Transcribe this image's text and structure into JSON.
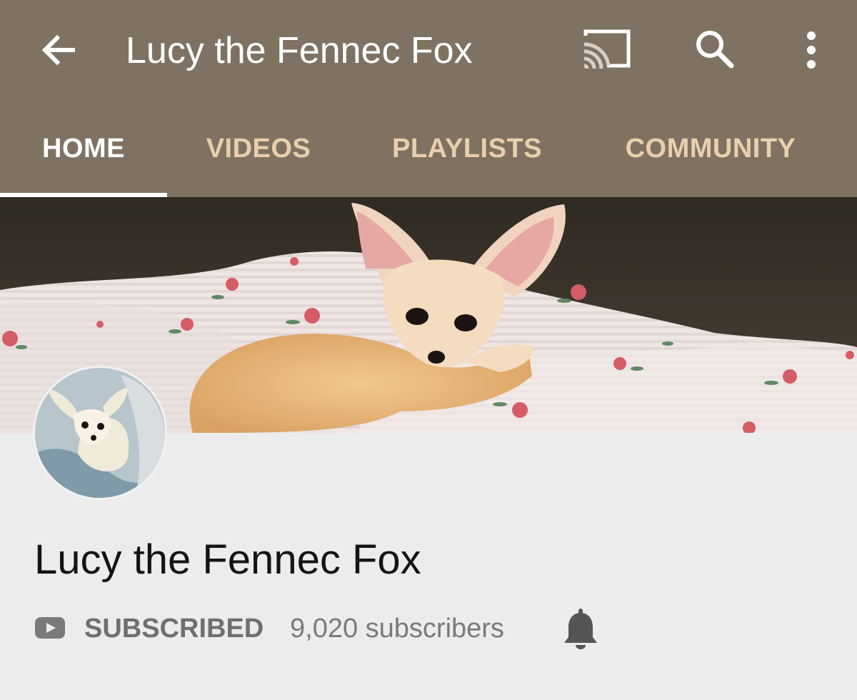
{
  "header": {
    "title": "Lucy the Fennec Fox",
    "back_icon": "arrow-back-icon",
    "cast_icon": "cast-icon",
    "search_icon": "search-icon",
    "more_icon": "more-vert-icon",
    "background_color": "#7f7262"
  },
  "tabs": [
    {
      "label": "HOME",
      "active": true
    },
    {
      "label": "VIDEOS",
      "active": false
    },
    {
      "label": "PLAYLISTS",
      "active": false
    },
    {
      "label": "COMMUNITY",
      "active": false
    }
  ],
  "colors": {
    "active_tab": "#ffffff",
    "inactive_tab": "#e8cfae",
    "page_background": "#ececec"
  },
  "channel": {
    "name": "Lucy the Fennec Fox",
    "subscribe_icon": "youtube-play-icon",
    "subscribe_status": "SUBSCRIBED",
    "subscribers": "9,020 subscribers",
    "notification_icon": "bell-icon"
  }
}
